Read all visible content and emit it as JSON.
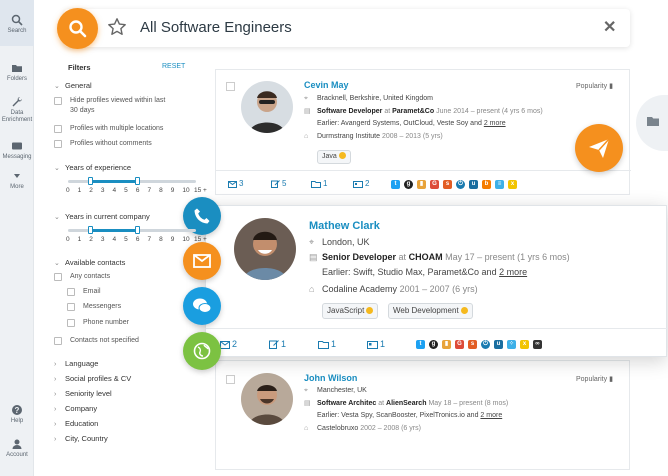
{
  "nav": {
    "items": [
      {
        "label": "Search",
        "icon": "search-icon"
      },
      {
        "label": "Folders",
        "icon": "folder-icon"
      },
      {
        "label": "Data Enrichment",
        "icon": "wrench-icon"
      },
      {
        "label": "Messaging",
        "icon": "mail-icon"
      },
      {
        "label": "More",
        "icon": "chevron-down-icon"
      },
      {
        "label": "Help",
        "icon": "help-icon"
      },
      {
        "label": "Account",
        "icon": "account-icon"
      }
    ]
  },
  "search": {
    "query": "All Software Engineers",
    "accent": "#f5901e"
  },
  "filters": {
    "title": "Filters",
    "reset": "RESET",
    "general": "General",
    "general_options": [
      "Hide profiles viewed within last 30 days",
      "Profiles with multiple locations",
      "Profiles without comments"
    ],
    "years_experience": "Years of experience",
    "years_company": "Years in current company",
    "ticks": [
      "0",
      "1",
      "2",
      "3",
      "4",
      "5",
      "6",
      "7",
      "8",
      "9",
      "10",
      "15 +"
    ],
    "range": [
      2,
      6
    ],
    "available_contacts": "Available contacts",
    "contact_options": [
      "Any contacts",
      "Email",
      "Messengers",
      "Phone number",
      "Contacts not specified"
    ],
    "collapsed": [
      "Language",
      "Social profiles & CV",
      "Seniority level",
      "Company",
      "Education",
      "City, Country"
    ]
  },
  "results": [
    {
      "name": "Cevin May",
      "location": "Bracknell, Berkshire, United Kingdom",
      "role": "Software Developer",
      "at": "at",
      "company": "Paramet&Co",
      "period": "June 2014 – present (4 yrs 6 mos)",
      "earlier": "Earlier: Avangerd Systems, OutCloud, Veste Soy and",
      "more": "2 more",
      "school": "Durmstrang Institute",
      "school_period": "2008 – 2013 (5 yrs)",
      "tags": [
        "Java"
      ],
      "popularity": "Popularity",
      "stats": [
        "3",
        "5",
        "1",
        "2"
      ]
    },
    {
      "name": "Mathew Clark",
      "location": "London, UK",
      "role": "Senior Developer",
      "at": "at",
      "company": "CHOAM",
      "period": "May 17 – present (1 yrs 6 mos)",
      "earlier": "Earlier: Swift, Studio Max, Paramet&Co and",
      "more": "2 more",
      "school": "Codaline Academy",
      "school_period": "2001 – 2007 (6 yrs)",
      "tags": [
        "JavaScript",
        "Web Development"
      ],
      "stats": [
        "2",
        "1",
        "1",
        "1"
      ]
    },
    {
      "name": "John Wilson",
      "location": "Manchester, UK",
      "role": "Software Architec",
      "at": "at",
      "company": "AlienSearch",
      "period": "May 18 – present (8 mos)",
      "earlier": "Earlier: Vesta Spy, ScanBooster, PixelTronics.io and",
      "more": "2 more",
      "school": "Castelobruxo",
      "school_period": "2002 – 2008 (6 yrs)",
      "popularity": "Popularity"
    }
  ]
}
